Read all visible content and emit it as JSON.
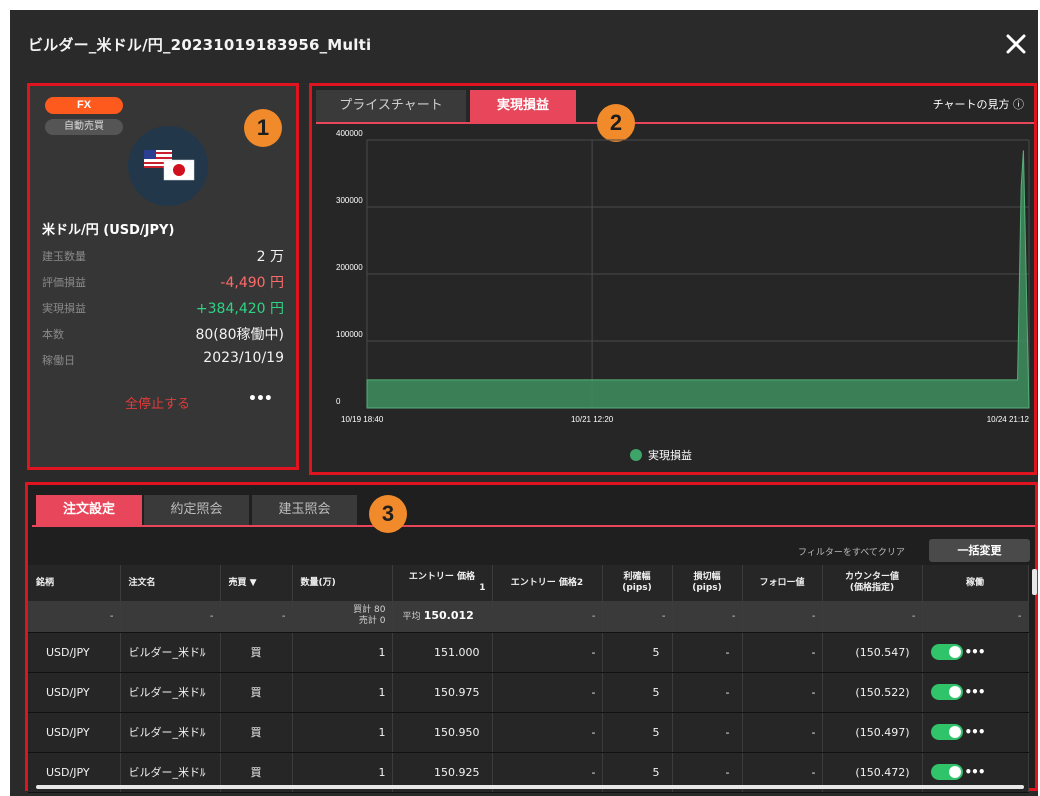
{
  "window": {
    "title": "ビルダー_米ドル/円_20231019183956_Multi"
  },
  "markers": [
    "1",
    "2",
    "3"
  ],
  "summary": {
    "badge_fx": "FX",
    "badge_auto": "自動売買",
    "flags": "us-jp-flag-icon",
    "pair": "米ドル/円 (USD/JPY)",
    "stats": [
      {
        "label": "建玉数量",
        "value": "2 万"
      },
      {
        "label": "評価損益",
        "value": "-4,490 円"
      },
      {
        "label": "実現損益",
        "value": "+384,420 円"
      },
      {
        "label": "本数",
        "value": "80(80稼働中)"
      },
      {
        "label": "稼働日",
        "value": "2023/10/19"
      }
    ],
    "stop_all": "全停止する",
    "more": "•••"
  },
  "chart_panel": {
    "tabs": [
      {
        "label": "プライスチャート"
      },
      {
        "label": "実現損益"
      }
    ],
    "help": "チャートの見方 ⓘ",
    "colors": {
      "accent": "#e8465a",
      "area": "#3e8f5e"
    }
  },
  "chart_data": {
    "type": "area",
    "x_ticks": [
      "10/19 18:40",
      "10/21 12:20",
      "10/24 21:12"
    ],
    "y_ticks": [
      "0",
      "100000",
      "200000",
      "300000",
      "400000"
    ],
    "ylim": [
      0,
      400000
    ],
    "grid": true,
    "legend": "bottom",
    "series": [
      {
        "name": "実現損益",
        "points": [
          {
            "x": "10/19 18:40",
            "y": 42000
          },
          {
            "x": "10/21 12:20",
            "y": 42000
          },
          {
            "x": "10/24 19:05",
            "y": 42000
          },
          {
            "x": "10/24 19:45",
            "y": 330000
          },
          {
            "x": "10/24 20:10",
            "y": 384420
          },
          {
            "x": "10/24 21:12",
            "y": 0
          }
        ]
      }
    ]
  },
  "orders_panel": {
    "tabs": [
      {
        "label": "注文設定"
      },
      {
        "label": "約定照会"
      },
      {
        "label": "建玉照会"
      }
    ],
    "filter_clear": "フィルターをすべてクリア",
    "bulk_change": "一括変更",
    "columns": [
      {
        "l1": "銘柄",
        "l2": ""
      },
      {
        "l1": "注文名",
        "l2": ""
      },
      {
        "l1": "売買 ▼",
        "l2": ""
      },
      {
        "l1": "数量(万)",
        "l2": ""
      },
      {
        "l1": "エントリー 価格",
        "l2": "1"
      },
      {
        "l1": "エントリー 価格2",
        "l2": ""
      },
      {
        "l1": "利確幅",
        "l2": "(pips)"
      },
      {
        "l1": "損切幅",
        "l2": "(pips)"
      },
      {
        "l1": "フォロー値",
        "l2": ""
      },
      {
        "l1": "カウンター値",
        "l2": "(価格指定)"
      },
      {
        "l1": "稼働",
        "l2": ""
      }
    ],
    "summary_row": {
      "dash": "-",
      "buy_total": "買計 80",
      "sell_total": "売計 0",
      "avg_label": "平均",
      "avg_value": "150.012"
    },
    "rows": [
      {
        "pair": "USD/JPY",
        "name": "ビルダー_米ドﾙ",
        "side": "買",
        "qty": "1",
        "entry": "151.000",
        "entry2": "-",
        "tp": "5",
        "sl": "-",
        "follow": "-",
        "counter": "(150.547)"
      },
      {
        "pair": "USD/JPY",
        "name": "ビルダー_米ドﾙ",
        "side": "買",
        "qty": "1",
        "entry": "150.975",
        "entry2": "-",
        "tp": "5",
        "sl": "-",
        "follow": "-",
        "counter": "(150.522)"
      },
      {
        "pair": "USD/JPY",
        "name": "ビルダー_米ドﾙ",
        "side": "買",
        "qty": "1",
        "entry": "150.950",
        "entry2": "-",
        "tp": "5",
        "sl": "-",
        "follow": "-",
        "counter": "(150.497)"
      },
      {
        "pair": "USD/JPY",
        "name": "ビルダー_米ドﾙ",
        "side": "買",
        "qty": "1",
        "entry": "150.925",
        "entry2": "-",
        "tp": "5",
        "sl": "-",
        "follow": "-",
        "counter": "(150.472)"
      }
    ],
    "row_more": "•••"
  }
}
